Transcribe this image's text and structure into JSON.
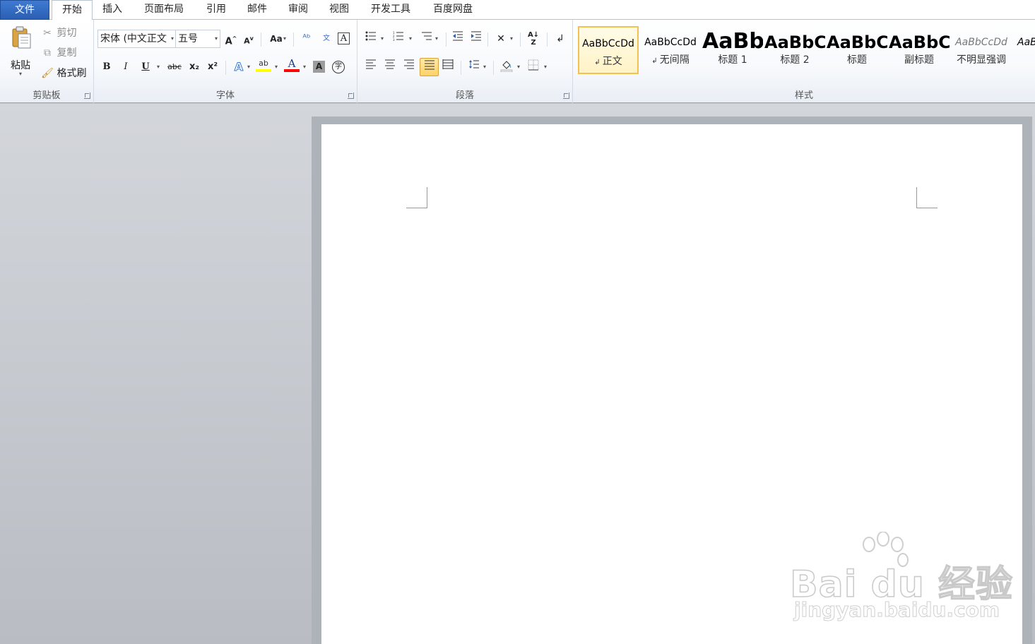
{
  "tabs": [
    {
      "label": "文件"
    },
    {
      "label": "开始"
    },
    {
      "label": "插入"
    },
    {
      "label": "页面布局"
    },
    {
      "label": "引用"
    },
    {
      "label": "邮件"
    },
    {
      "label": "审阅"
    },
    {
      "label": "视图"
    },
    {
      "label": "开发工具"
    },
    {
      "label": "百度网盘"
    }
  ],
  "clipboard": {
    "group_label": "剪贴板",
    "paste": "粘贴",
    "cut": "剪切",
    "copy": "复制",
    "format_painter": "格式刷"
  },
  "font": {
    "group_label": "字体",
    "font_name": "宋体 (中文正文",
    "font_size": "五号",
    "grow": "A",
    "shrink": "A",
    "change_case": "Aa",
    "bold": "B",
    "italic": "I",
    "underline": "U",
    "strikethrough": "abc",
    "subscript": "x₂",
    "superscript": "x²",
    "text_effect": "A",
    "highlight": "ab",
    "font_color": "A",
    "char_shading": "A",
    "enclose": "字",
    "phonetic": "文",
    "border_char": "A"
  },
  "paragraph": {
    "group_label": "段落"
  },
  "styles": {
    "group_label": "样式",
    "items": [
      {
        "sample": "AaBbCcDd",
        "name": "正文"
      },
      {
        "sample": "AaBbCcDd",
        "name": "无间隔"
      },
      {
        "sample": "AaBb",
        "name": "标题 1"
      },
      {
        "sample": "AaBbC",
        "name": "标题 2"
      },
      {
        "sample": "AaBbC",
        "name": "标题"
      },
      {
        "sample": "AaBbC",
        "name": "副标题"
      },
      {
        "sample": "AaBbCcDd",
        "name": "不明显强调"
      },
      {
        "sample": "AaB",
        "name": ""
      }
    ]
  },
  "watermark": {
    "main": "Bai du 经验",
    "sub": "jingyan.baidu.com"
  },
  "colors": {
    "file_tab": "#2a5fb3",
    "highlight_yellow": "#ffff00",
    "font_red": "#ff0000",
    "selected_style": "#f2c14e"
  }
}
